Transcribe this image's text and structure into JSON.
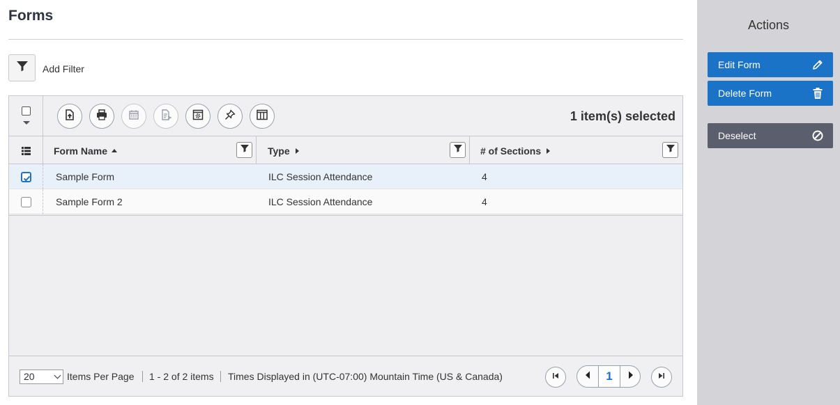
{
  "page": {
    "title": "Forms"
  },
  "filter": {
    "add_label": "Add Filter"
  },
  "toolbar": {
    "selected_text": "1 item(s) selected",
    "buttons": [
      "export-icon",
      "print-icon",
      "calendar-icon",
      "report-icon",
      "settings-window-icon",
      "pin-icon",
      "columns-icon"
    ]
  },
  "columns": [
    {
      "label": "Form Name",
      "sort": "ascending"
    },
    {
      "label": "Type",
      "sort": "none"
    },
    {
      "label": "# of Sections",
      "sort": "none"
    }
  ],
  "rows": [
    {
      "name": "Sample Form",
      "type": "ILC Session Attendance",
      "sections": "4",
      "selected": true
    },
    {
      "name": "Sample Form 2",
      "type": "ILC Session Attendance",
      "sections": "4",
      "selected": false
    }
  ],
  "footer": {
    "page_size": "20",
    "items_per_page_label": "Items Per Page",
    "range_text": "1 - 2 of 2 items",
    "timezone_text": "Times Displayed in (UTC-07:00) Mountain Time (US & Canada)",
    "current_page": "1"
  },
  "sidebar": {
    "title": "Actions",
    "actions": [
      {
        "label": "Edit Form",
        "icon": "pencil-icon",
        "color": "#1a73c7"
      },
      {
        "label": "Delete Form",
        "icon": "trash-icon",
        "color": "#1a73c7"
      },
      {
        "label": "Deselect",
        "icon": "cancel-icon",
        "color": "#5b5e6d"
      }
    ]
  },
  "colors": {
    "accent": "#1a73c7",
    "selected_row": "#e8f1fa",
    "sidebar": "#d4d4d8"
  }
}
